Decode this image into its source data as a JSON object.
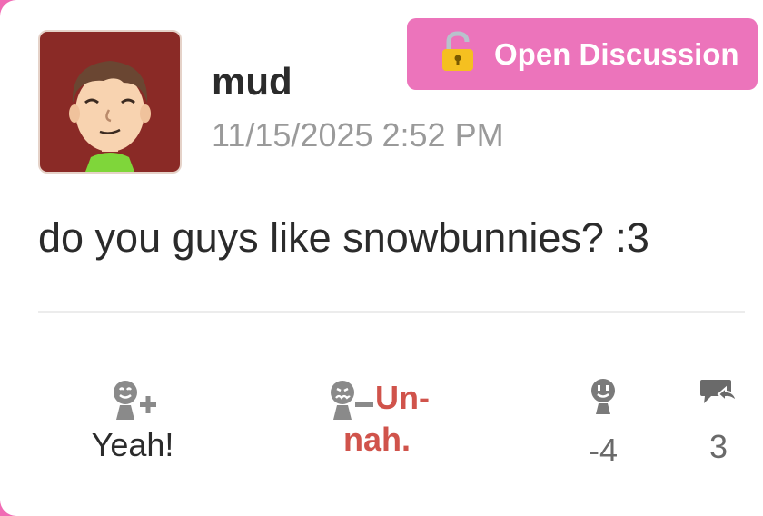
{
  "post": {
    "username": "mud",
    "timestamp": "11/15/2025 2:52 PM",
    "badge_label": "Open Discussion",
    "body": "do you guys like snowbunnies? :3"
  },
  "actions": {
    "yeah_label": "Yeah!",
    "unnah_label_line1": "Un-",
    "unnah_label_line2": "nah.",
    "yeah_count": "-4",
    "reply_count": "3"
  },
  "icons": {
    "badge": "unlocked-padlock-icon",
    "yeah": "mii-plus-icon",
    "unnah": "mii-minus-icon",
    "count": "mii-face-icon",
    "reply": "reply-bubble-icon"
  },
  "colors": {
    "accent_pink": "#ec74bb",
    "unnah_red": "#d0534b",
    "icon_gray": "#8a8a8a"
  }
}
